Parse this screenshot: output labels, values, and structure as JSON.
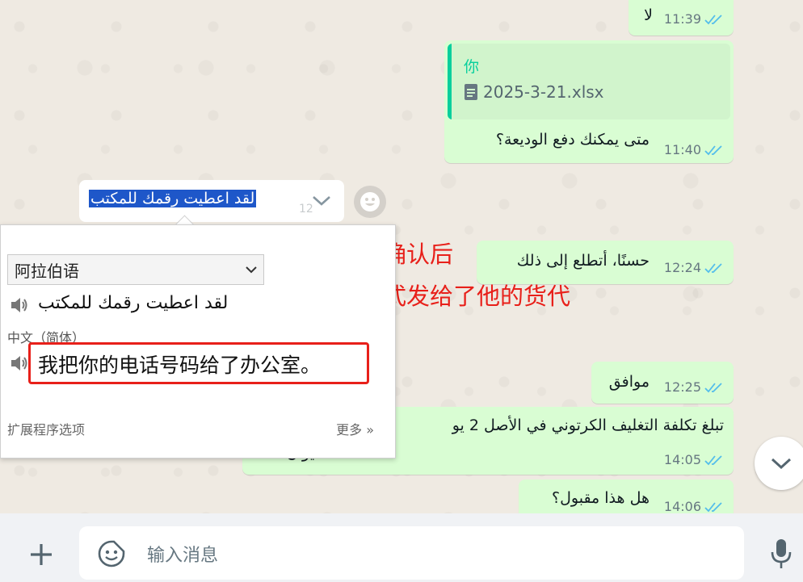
{
  "messages": [
    {
      "text": "لا",
      "time": "11:39"
    },
    {
      "quote_author": "你",
      "quote_file": "2025-3-21.xlsx",
      "text": "متى يمكنك دفع الوديعة؟",
      "time": "11:40"
    },
    {
      "text": "لقد اعطيت رقمك للمكتب",
      "time": "12"
    },
    {
      "text": "حسنًا، أتطلع إلى ذلك",
      "time": "12:24"
    },
    {
      "text": "موافق",
      "time": "12:25"
    },
    {
      "text": "تبلغ تكلفة التغليف الكرتوني في الأصل 2 يو",
      "text2": "؟ يوان فقط",
      "time": "14:05"
    },
    {
      "text": "هل هذا مقبول؟",
      "time": "14:06"
    }
  ],
  "translate_popup": {
    "source_language": "阿拉伯语",
    "source_text": "لقد اعطيت رقمك للمكتب",
    "target_language": "中文（简体）",
    "target_text": "我把你的电话号码给了办公室。",
    "extension_options": "扩展程序选项",
    "more": "更多 »"
  },
  "annotation": {
    "line1": "产品细节确认后",
    "line2": "把联系方式发给了他的货代"
  },
  "composer": {
    "placeholder": "输入消息"
  },
  "colors": {
    "outgoing_bubble": "#d9fdd3",
    "accent": "#06cf9c",
    "annotation_red": "#e8201a",
    "selection_blue": "#1e57c9",
    "read_tick": "#53bdeb"
  },
  "icons": [
    "double-check-icon",
    "document-icon",
    "chevron-down-icon",
    "emoji-icon",
    "speaker-icon",
    "plus-icon",
    "sticker-icon",
    "microphone-icon"
  ]
}
